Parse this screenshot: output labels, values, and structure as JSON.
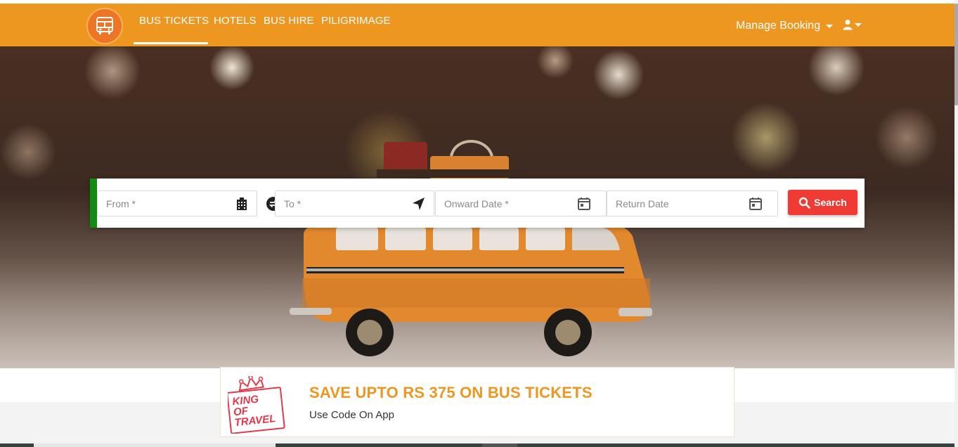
{
  "header": {
    "logo_icon": "bus-icon",
    "nav": [
      {
        "label": "BUS TICKETS",
        "active": true
      },
      {
        "label": "HOTELS",
        "active": false
      },
      {
        "label": "BUS HIRE",
        "active": false
      },
      {
        "label": "PILIGRIMAGE",
        "active": false
      }
    ],
    "manage_booking": "Manage Booking",
    "user_icon": "user-icon",
    "bar_color": "#ed9721"
  },
  "search": {
    "accent_color": "#138a13",
    "from_placeholder": "From *",
    "from_icon": "building-icon",
    "swap_icon": "swap-icon",
    "to_placeholder": "To *",
    "to_icon": "navigation-arrow-icon",
    "onward_placeholder": "Onward Date *",
    "return_placeholder": "Return Date",
    "calendar_icon": "calendar-icon",
    "button_label": "Search",
    "button_color": "#ef3b33"
  },
  "promo": {
    "logo_text": [
      "KING",
      "OF",
      "TRAVEL"
    ],
    "logo_icon": "crown-icon",
    "title": "SAVE UPTO RS 375 ON BUS TICKETS",
    "subtitle": "Use Code On App"
  }
}
